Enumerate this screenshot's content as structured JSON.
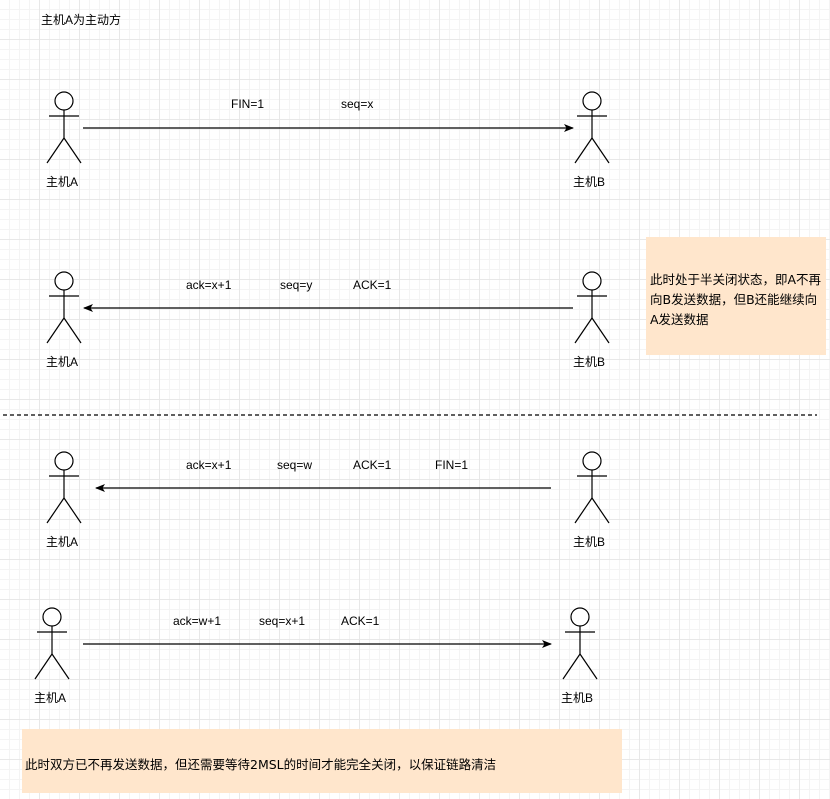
{
  "header": {
    "title": "主机A为主动方"
  },
  "phases": [
    {
      "left_actor": "主机A",
      "right_actor": "主机B",
      "direction": "A->B",
      "fields": [
        "FIN=1",
        "seq=x"
      ]
    },
    {
      "left_actor": "主机A",
      "right_actor": "主机B",
      "direction": "B->A",
      "fields": [
        "ack=x+1",
        "seq=y",
        "ACK=1"
      ]
    },
    {
      "left_actor": "主机A",
      "right_actor": "主机B",
      "direction": "B->A",
      "fields": [
        "ack=x+1",
        "seq=w",
        "ACK=1",
        "FIN=1"
      ]
    },
    {
      "left_actor": "主机A",
      "right_actor": "主机B",
      "direction": "A->B",
      "fields": [
        "ack=w+1",
        "seq=x+1",
        "ACK=1"
      ]
    }
  ],
  "notes": {
    "half_close": "此时处于半关闭状态，即A不再向B发送数据，但B还能继续向A发送数据",
    "time_wait": "此时双方已不再发送数据，但还需要等待2MSL的时间才能完全关闭，以保证链路清洁"
  },
  "colors": {
    "note_fill": "#ffe6cc",
    "line": "#000000",
    "grid": "#e8e8e8"
  }
}
